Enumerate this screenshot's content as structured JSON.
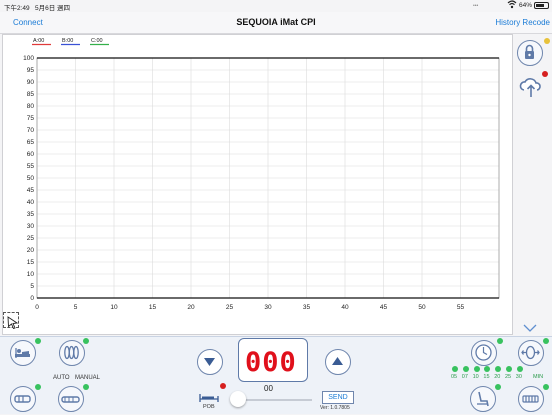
{
  "status": {
    "time": "下午2:49",
    "date": "5月6日 週四",
    "battery": "64%"
  },
  "nav": {
    "left_link": "Connect",
    "title": "SEQUOIA iMat CPI",
    "right_link": "History Recode"
  },
  "chart_data": {
    "type": "line",
    "legend": [
      {
        "name": "A:00",
        "color": "#e03a3a"
      },
      {
        "name": "B:00",
        "color": "#3a52d6"
      },
      {
        "name": "C:00",
        "color": "#34b04a"
      }
    ],
    "series": [
      {
        "name": "A:00",
        "values": []
      },
      {
        "name": "B:00",
        "values": []
      },
      {
        "name": "C:00",
        "values": []
      }
    ],
    "x_ticks": [
      "0",
      "5",
      "10",
      "15",
      "20",
      "25",
      "30",
      "35",
      "40",
      "45",
      "50",
      "55"
    ],
    "y_ticks": [
      "0",
      "5",
      "10",
      "15",
      "20",
      "25",
      "30",
      "35",
      "40",
      "45",
      "50",
      "55",
      "60",
      "65",
      "70",
      "75",
      "80",
      "85",
      "90",
      "95",
      "100"
    ],
    "xlim": [
      0,
      60
    ],
    "ylim": [
      0,
      100
    ],
    "grid": true,
    "legend_position": "top-left"
  },
  "controls": {
    "display_value": "000",
    "display_sub": "00",
    "auto_label": "AUTO",
    "manual_label": "MANUAL",
    "pob_label": "POB",
    "send_label": "SEND",
    "version": "Ver: 1.0.7805",
    "timer_minutes": [
      "05",
      "07",
      "10",
      "15",
      "20",
      "25",
      "30"
    ],
    "timer_unit": "MIN",
    "slider_value": 0
  },
  "colors": {
    "accent": "#1a7bd6",
    "indicator_green": "#38c25f",
    "indicator_red": "#d62020",
    "indicator_yellow": "#e8c23a",
    "digit_red": "#e0101b"
  }
}
